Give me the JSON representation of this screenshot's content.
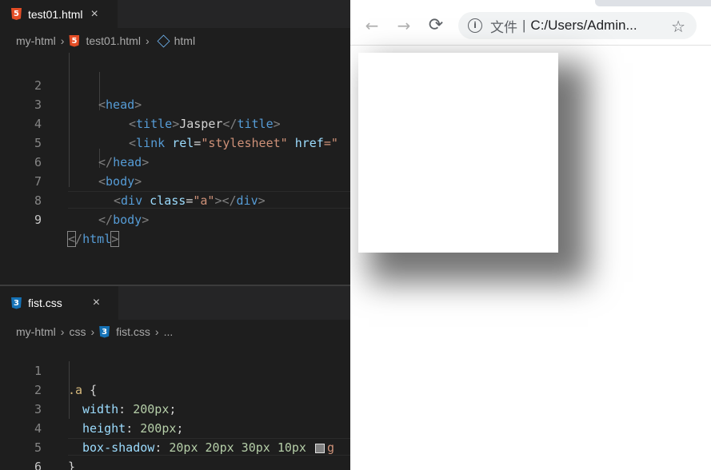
{
  "editor_top": {
    "tab": {
      "label": "test01.html",
      "close": "×",
      "badge": "5"
    },
    "breadcrumb": [
      "my-html",
      "test01.html",
      "html"
    ],
    "lines": [
      {
        "n": "2"
      },
      {
        "n": "3"
      },
      {
        "n": "4"
      },
      {
        "n": "5"
      },
      {
        "n": "6"
      },
      {
        "n": "7"
      },
      {
        "n": "8"
      },
      {
        "n": "9"
      }
    ],
    "code": {
      "l2_tag": "head",
      "l3_tag": "title",
      "l3_text": "Jasper",
      "l3_endtag": "title",
      "l4_tag": "link",
      "l4_attr1": "rel",
      "l4_val1": "\"stylesheet\"",
      "l4_attr2": "href",
      "l4_eq": "=\"",
      "l5_tag": "head",
      "l6_tag": "body",
      "l7_tag": "div",
      "l7_attr": "class",
      "l7_val": "\"a\"",
      "l7_endtag": "div",
      "l8_tag": "body",
      "l9_tag": "html"
    }
  },
  "editor_bottom": {
    "tab": {
      "label": "fist.css",
      "close": "×",
      "badge": "3"
    },
    "breadcrumb": [
      "my-html",
      "css",
      "fist.css",
      "..."
    ],
    "lines": [
      {
        "n": "1"
      },
      {
        "n": "2"
      },
      {
        "n": "3"
      },
      {
        "n": "4"
      },
      {
        "n": "5"
      },
      {
        "n": "6"
      }
    ],
    "code": {
      "selector": ".a",
      "open": "{",
      "p1": "width",
      "v1": "200px",
      "p2": "height",
      "v2": "200px",
      "p3": "box-shadow",
      "v3": "20px 20px 30px 10px",
      "v3_tail": "g",
      "close": "}"
    }
  },
  "browser": {
    "back": "←",
    "forward": "→",
    "reload": "⟳",
    "info": "i",
    "file_label": "文件",
    "divider": "|",
    "url": "C:/Users/Admin...",
    "star": "☆"
  }
}
